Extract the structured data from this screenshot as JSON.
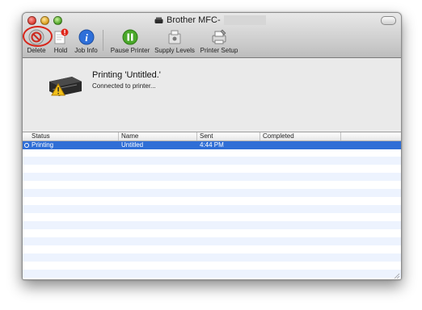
{
  "window": {
    "title": "Brother MFC-"
  },
  "toolbar": {
    "delete_label": "Delete",
    "hold_label": "Hold",
    "job_info_label": "Job Info",
    "pause_label": "Pause Printer",
    "supply_label": "Supply Levels",
    "setup_label": "Printer Setup"
  },
  "status": {
    "title": "Printing 'Untitled.'",
    "subtitle": "Connected to printer..."
  },
  "table": {
    "columns": [
      "Status",
      "Name",
      "Sent",
      "Completed"
    ],
    "rows": [
      {
        "status": "Printing",
        "name": "Untitled",
        "sent": "4:44 PM",
        "completed": ""
      }
    ]
  },
  "colors": {
    "selection": "#2f6ed6",
    "annotation_circle": "#d8261b",
    "alt_row": "#edf3fe"
  }
}
